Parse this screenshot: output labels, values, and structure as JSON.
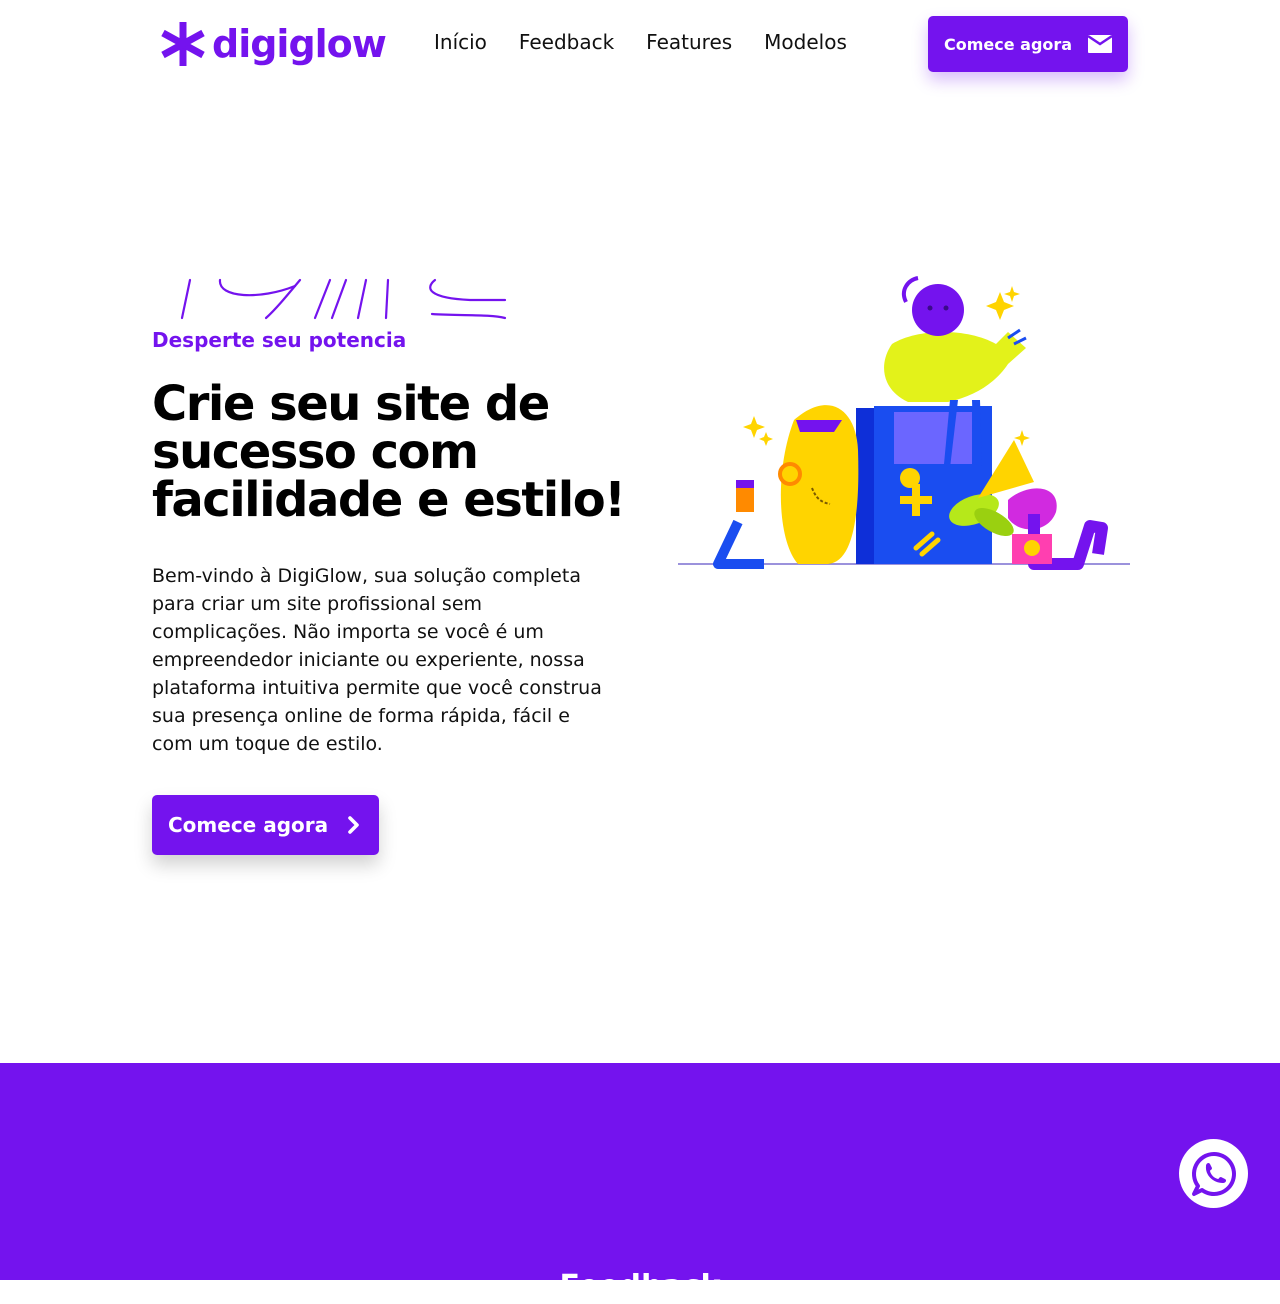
{
  "brand": {
    "name": "digiglow",
    "color": "#7413ee"
  },
  "nav": {
    "items": [
      {
        "label": "Início"
      },
      {
        "label": "Feedback"
      },
      {
        "label": "Features"
      },
      {
        "label": "Modelos"
      }
    ],
    "cta_label": "Comece agora",
    "cta_icon": "mail-icon"
  },
  "hero": {
    "eyebrow": "Desperte seu potencia",
    "headline": "Crie seu site de sucesso com facilidade e estilo!",
    "intro": "Bem-vindo à DigiGlow, sua solução completa para criar um site profissional sem complicações. Não importa se você é um empreendedor iniciante ou experiente, nossa plataforma intuitiva permite que você construa sua presença online de forma rápida, fácil e com um toque de estilo.",
    "cta_label": "Comece agora",
    "cta_icon": "chevron-right-icon"
  },
  "feedback_section": {
    "title": "Feedback"
  },
  "floating": {
    "icon": "whatsapp-icon"
  }
}
